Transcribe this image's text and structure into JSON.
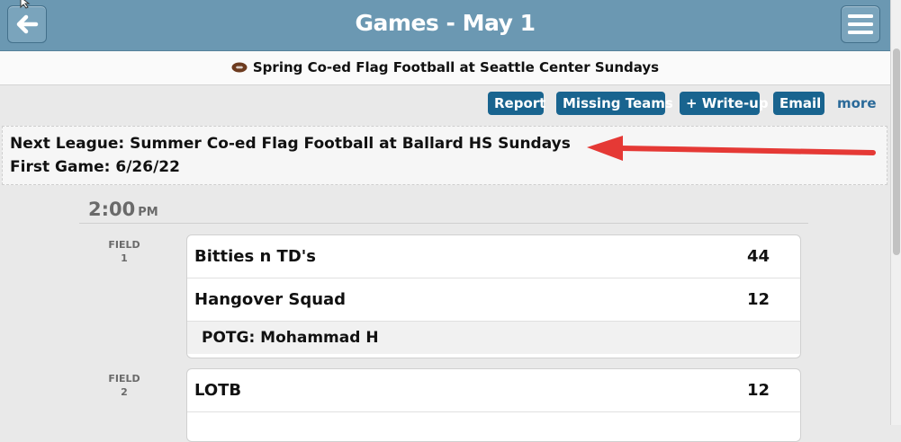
{
  "header": {
    "title": "Games - May 1",
    "back_icon": "back-arrow-icon",
    "menu_icon": "hamburger-menu-icon",
    "bar_color": "#6b98b2"
  },
  "league": {
    "icon": "football-icon",
    "name": "Spring Co-ed Flag Football at Seattle Center Sundays"
  },
  "actions": {
    "report": "Report",
    "missing_teams": "Missing Teams",
    "write_up": "+ Write-up",
    "email": "Email",
    "more": "more",
    "button_color": "#19648f"
  },
  "notice": {
    "line1": "Next League: Summer Co-ed Flag Football at Ballard HS Sundays",
    "line2": "First Game: 6/26/22",
    "annotation_arrow_color": "#e53935"
  },
  "schedule": {
    "time": "2:00",
    "ampm": "PM",
    "games": [
      {
        "field_label": "FIELD",
        "field_number": "1",
        "team1": "Bitties n TD's",
        "score1": "44",
        "team2": "Hangover Squad",
        "score2": "12",
        "potg": "POTG: Mohammad H"
      },
      {
        "field_label": "FIELD",
        "field_number": "2",
        "team1": "LOTB",
        "score1": "12"
      }
    ]
  }
}
